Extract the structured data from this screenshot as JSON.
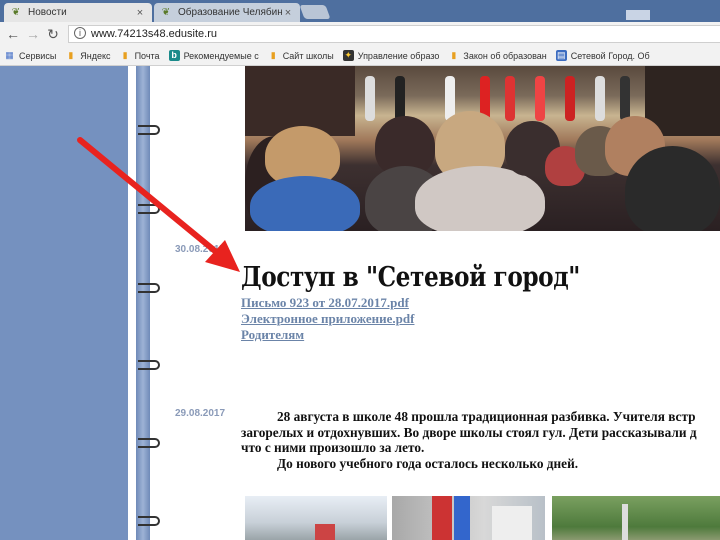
{
  "browser": {
    "tabs": [
      {
        "label": "Новости",
        "icon": "leaf-icon",
        "active": true
      },
      {
        "label": "Образование Челябин",
        "icon": "leaf-icon",
        "active": false
      }
    ],
    "close_symbol": "×",
    "address": "www.74213s48.edusite.ru",
    "bookmarks": [
      {
        "label": "Сервисы",
        "icon": "apps-icon"
      },
      {
        "label": "Яндекс",
        "icon": "bookmark-icon"
      },
      {
        "label": "Почта",
        "icon": "bookmark-icon"
      },
      {
        "label": "Рекомендуемые с",
        "icon": "bing-icon"
      },
      {
        "label": "Сайт школы",
        "icon": "bookmark-icon"
      },
      {
        "label": "Управление образо",
        "icon": "emblem-icon"
      },
      {
        "label": "Закон об образован",
        "icon": "bookmark-icon"
      },
      {
        "label": "Сетевой Город. Об",
        "icon": "page-icon"
      }
    ]
  },
  "news": [
    {
      "date": "30.08.2017",
      "title": "Доступ в \"Сетевой город\"",
      "links": [
        "Письмо 923 от 28.07.2017.pdf",
        "Электронное приложение.pdf",
        "Родителям"
      ]
    },
    {
      "date": "29.08.2017",
      "paragraph_lines": [
        "28 августа в школе 48 прошла традиционная разбивка. Учителя встр",
        "загорелых и отдохнувших. Во дворе школы стоял гул. Дети рассказывали д",
        "что с ними произошло за лето.",
        "До нового учебного года осталось несколько дней."
      ]
    }
  ],
  "colors": {
    "sidebar": "#7591bf",
    "link": "#6b84a8",
    "date": "#8a9ab8",
    "arrow": "#e8231f"
  }
}
